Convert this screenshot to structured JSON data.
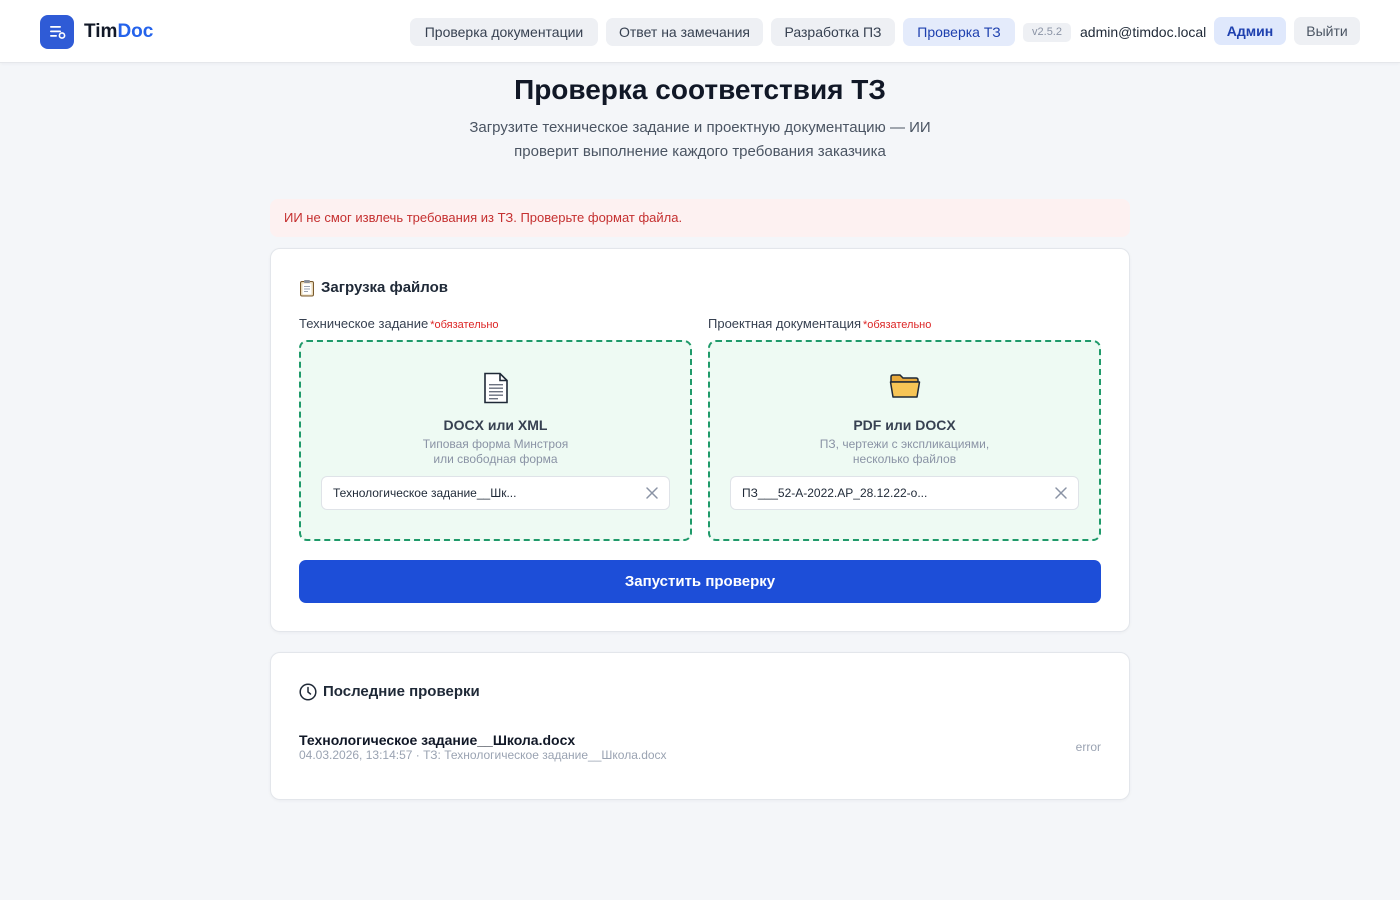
{
  "header": {
    "brand_part1": "Tim",
    "brand_part2": "Doc",
    "nav": [
      {
        "label": "Проверка документации"
      },
      {
        "label": "Ответ на замечания"
      },
      {
        "label": "Разработка ПЗ"
      },
      {
        "label": "Проверка ТЗ",
        "active": true
      }
    ],
    "version": "v2.5.2",
    "email": "admin@timdoc.local",
    "admin_label": "Админ",
    "logout_label": "Выйти"
  },
  "page": {
    "title": "Проверка соответствия ТЗ",
    "subtitle": "Загрузите техническое задание и проектную документацию — ИИ проверит выполнение каждого требования заказчика"
  },
  "error_message": "ИИ не смог извлечь требования из ТЗ. Проверьте формат файла.",
  "upload": {
    "title": "Загрузка файлов",
    "tz": {
      "label": "Техническое задание",
      "required": "*обязательно",
      "format": "DOCX или XML",
      "desc_line1": "Типовая форма Минстроя",
      "desc_line2": "или свободная форма",
      "file_name": "Технологическое задание__Шк..."
    },
    "pd": {
      "label": "Проектная документация",
      "required": "*обязательно",
      "format": "PDF или DOCX",
      "desc_line1": "ПЗ, чертежи с экспликациями,",
      "desc_line2": "несколько файлов",
      "file_name": "ПЗ___52-А-2022.АР_28.12.22-о..."
    },
    "run_label": "Запустить проверку"
  },
  "recent": {
    "title": "Последние проверки",
    "items": [
      {
        "name": "Технологическое задание__Школа.docx",
        "meta": "04.03.2026, 13:14:57 · ТЗ: Технологическое задание__Школа.docx",
        "status": "error"
      }
    ]
  },
  "colors": {
    "accent": "#1d4ed8",
    "dropzone_border": "#1f9a6a",
    "dropzone_bg": "#eefaf3",
    "error_bg": "#fdf1f1",
    "error_text": "#c53030"
  },
  "icons": {
    "logo": "document-list-icon",
    "tz_dropzone": "document-icon",
    "pd_dropzone": "folder-icon",
    "upload_title": "clipboard-icon",
    "recent_title": "clock-icon",
    "remove_file": "close-icon"
  }
}
